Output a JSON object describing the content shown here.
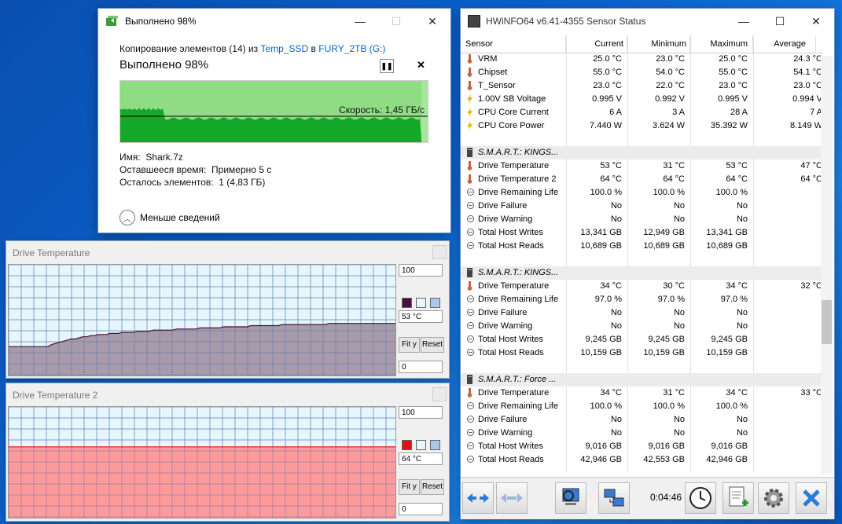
{
  "copy_dialog": {
    "title": "Выполнено 98%",
    "line_prefix": "Копирование элементов (14) из ",
    "source": "Temp_SSD",
    "line_mid": " в ",
    "destination": "FURY_2TB (G:)",
    "percent_label": "Выполнено 98%",
    "progress": 0.98,
    "speed": "Скорость: 1,45 ГБ/с",
    "name_label": "Имя:",
    "name_value": "Shark.7z",
    "time_label": "Оставшееся время:",
    "time_value": "Примерно 5 с",
    "items_label": "Осталось элементов:",
    "items_value": "1 (4,83 ГБ)",
    "less_details": "Меньше сведений"
  },
  "graph1": {
    "title": "Drive Temperature",
    "max": "100",
    "current": "53 °C",
    "min": "0",
    "fit": "Fit y",
    "reset": "Reset",
    "color": "#4a0f3a",
    "fill": "#a79aaa",
    "values": [
      26,
      26,
      26,
      26,
      26,
      26,
      26,
      26,
      26,
      26,
      26,
      28,
      29,
      30,
      31,
      32,
      33,
      33,
      34,
      35,
      35,
      36,
      36,
      37,
      37,
      37,
      38,
      38,
      38,
      39,
      39,
      39,
      39,
      40,
      40,
      40,
      40,
      41,
      41,
      41,
      41,
      41,
      41,
      42,
      42,
      42,
      42,
      42,
      42,
      43,
      43,
      43,
      43,
      43,
      43,
      44,
      44,
      44,
      44,
      44,
      44,
      44,
      45,
      45,
      45,
      45,
      45,
      45,
      45,
      45,
      46,
      46,
      46,
      46,
      46,
      46,
      46,
      46,
      46,
      46,
      46,
      46,
      47,
      47,
      47,
      47,
      47,
      47,
      47,
      47,
      47,
      47,
      47,
      47,
      47,
      47,
      47,
      47,
      47,
      47
    ]
  },
  "graph2": {
    "title": "Drive Temperature 2",
    "max": "100",
    "current": "64 °C",
    "min": "0",
    "fit": "Fit y",
    "reset": "Reset",
    "color": "#e01010",
    "fill": "#ff9a9a",
    "values": [
      64,
      64,
      64,
      64,
      64,
      64,
      64,
      64,
      64,
      64,
      64,
      64,
      64,
      64,
      64,
      64,
      64,
      64,
      64,
      64
    ]
  },
  "hwinfo": {
    "title": "HWiNFO64 v6.41-4355 Sensor Status",
    "columns": [
      "Sensor",
      "Current",
      "Minimum",
      "Maximum",
      "Average"
    ],
    "elapsed": "0:04:46",
    "rows": [
      {
        "icon": "thermometer-icon",
        "name": "VRM",
        "cur": "25.0 °C",
        "min": "23.0 °C",
        "max": "25.0 °C",
        "avg": "24.3 °C"
      },
      {
        "icon": "thermometer-icon",
        "name": "Chipset",
        "cur": "55.0 °C",
        "min": "54.0 °C",
        "max": "55.0 °C",
        "avg": "54.1 °C"
      },
      {
        "icon": "thermometer-icon",
        "name": "T_Sensor",
        "cur": "23.0 °C",
        "min": "22.0 °C",
        "max": "23.0 °C",
        "avg": "23.0 °C"
      },
      {
        "icon": "bolt-icon",
        "name": "1.00V SB Voltage",
        "cur": "0.995 V",
        "min": "0.992 V",
        "max": "0.995 V",
        "avg": "0.994 V"
      },
      {
        "icon": "bolt-icon",
        "name": "CPU Core Current",
        "cur": "6 A",
        "min": "3 A",
        "max": "28 A",
        "avg": "7 A"
      },
      {
        "icon": "bolt-icon",
        "name": "CPU Core Power",
        "cur": "7.440 W",
        "min": "3.624 W",
        "max": "35.392 W",
        "avg": "8.149 W"
      },
      {
        "icon": "",
        "name": "",
        "cur": "",
        "min": "",
        "max": "",
        "avg": ""
      },
      {
        "group": true,
        "icon": "drive-icon",
        "name": "S.M.A.R.T.: KINGS...",
        "cur": "",
        "min": "",
        "max": "",
        "avg": ""
      },
      {
        "icon": "thermometer-icon",
        "name": "Drive Temperature",
        "cur": "53 °C",
        "min": "31 °C",
        "max": "53 °C",
        "avg": "47 °C"
      },
      {
        "icon": "thermometer-icon",
        "name": "Drive Temperature 2",
        "cur": "64 °C",
        "min": "64 °C",
        "max": "64 °C",
        "avg": "64 °C"
      },
      {
        "icon": "gauge-icon",
        "name": "Drive Remaining Life",
        "cur": "100.0 %",
        "min": "100.0 %",
        "max": "100.0 %",
        "avg": ""
      },
      {
        "icon": "gauge-icon",
        "name": "Drive Failure",
        "cur": "No",
        "min": "No",
        "max": "No",
        "avg": ""
      },
      {
        "icon": "gauge-icon",
        "name": "Drive Warning",
        "cur": "No",
        "min": "No",
        "max": "No",
        "avg": ""
      },
      {
        "icon": "gauge-icon",
        "name": "Total Host Writes",
        "cur": "13,341 GB",
        "min": "12,949 GB",
        "max": "13,341 GB",
        "avg": ""
      },
      {
        "icon": "gauge-icon",
        "name": "Total Host Reads",
        "cur": "10,689 GB",
        "min": "10,689 GB",
        "max": "10,689 GB",
        "avg": ""
      },
      {
        "icon": "",
        "name": "",
        "cur": "",
        "min": "",
        "max": "",
        "avg": ""
      },
      {
        "group": true,
        "icon": "drive-icon",
        "name": "S.M.A.R.T.: KINGS...",
        "cur": "",
        "min": "",
        "max": "",
        "avg": ""
      },
      {
        "icon": "thermometer-icon",
        "name": "Drive Temperature",
        "cur": "34 °C",
        "min": "30 °C",
        "max": "34 °C",
        "avg": "32 °C"
      },
      {
        "icon": "gauge-icon",
        "name": "Drive Remaining Life",
        "cur": "97.0 %",
        "min": "97.0 %",
        "max": "97.0 %",
        "avg": ""
      },
      {
        "icon": "gauge-icon",
        "name": "Drive Failure",
        "cur": "No",
        "min": "No",
        "max": "No",
        "avg": ""
      },
      {
        "icon": "gauge-icon",
        "name": "Drive Warning",
        "cur": "No",
        "min": "No",
        "max": "No",
        "avg": ""
      },
      {
        "icon": "gauge-icon",
        "name": "Total Host Writes",
        "cur": "9,245 GB",
        "min": "9,245 GB",
        "max": "9,245 GB",
        "avg": ""
      },
      {
        "icon": "gauge-icon",
        "name": "Total Host Reads",
        "cur": "10,159 GB",
        "min": "10,159 GB",
        "max": "10,159 GB",
        "avg": ""
      },
      {
        "icon": "",
        "name": "",
        "cur": "",
        "min": "",
        "max": "",
        "avg": ""
      },
      {
        "group": true,
        "icon": "drive-icon",
        "name": "S.M.A.R.T.: Force ...",
        "cur": "",
        "min": "",
        "max": "",
        "avg": ""
      },
      {
        "icon": "thermometer-icon",
        "name": "Drive Temperature",
        "cur": "34 °C",
        "min": "31 °C",
        "max": "34 °C",
        "avg": "33 °C"
      },
      {
        "icon": "gauge-icon",
        "name": "Drive Remaining Life",
        "cur": "100.0 %",
        "min": "100.0 %",
        "max": "100.0 %",
        "avg": ""
      },
      {
        "icon": "gauge-icon",
        "name": "Drive Failure",
        "cur": "No",
        "min": "No",
        "max": "No",
        "avg": ""
      },
      {
        "icon": "gauge-icon",
        "name": "Drive Warning",
        "cur": "No",
        "min": "No",
        "max": "No",
        "avg": ""
      },
      {
        "icon": "gauge-icon",
        "name": "Total Host Writes",
        "cur": "9,016 GB",
        "min": "9,016 GB",
        "max": "9,016 GB",
        "avg": ""
      },
      {
        "icon": "gauge-icon",
        "name": "Total Host Reads",
        "cur": "42,946 GB",
        "min": "42,553 GB",
        "max": "42,946 GB",
        "avg": ""
      }
    ]
  }
}
